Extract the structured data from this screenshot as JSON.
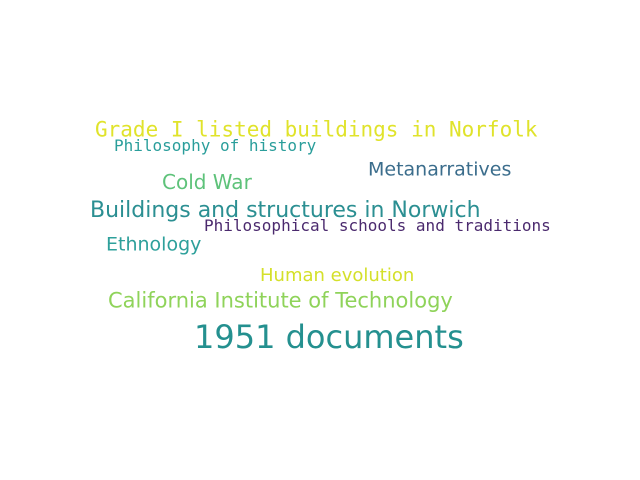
{
  "cloud": {
    "words": [
      {
        "text": "Grade I listed buildings in Norfolk",
        "color": "#e0e32b"
      },
      {
        "text": "Philosophy of history",
        "color": "#2a9e9b"
      },
      {
        "text": "Metanarratives",
        "color": "#3b6d8c"
      },
      {
        "text": "Cold War",
        "color": "#5ec27a"
      },
      {
        "text": "Buildings and structures in Norwich",
        "color": "#2b8f92"
      },
      {
        "text": "Philosophical schools and traditions",
        "color": "#4b2a6e"
      },
      {
        "text": "Ethnology",
        "color": "#2ea09b"
      },
      {
        "text": "Human evolution",
        "color": "#d4e02a"
      },
      {
        "text": "California Institute of Technology",
        "color": "#8fd35a"
      },
      {
        "text": "1951 documents",
        "color": "#24908f"
      }
    ]
  }
}
